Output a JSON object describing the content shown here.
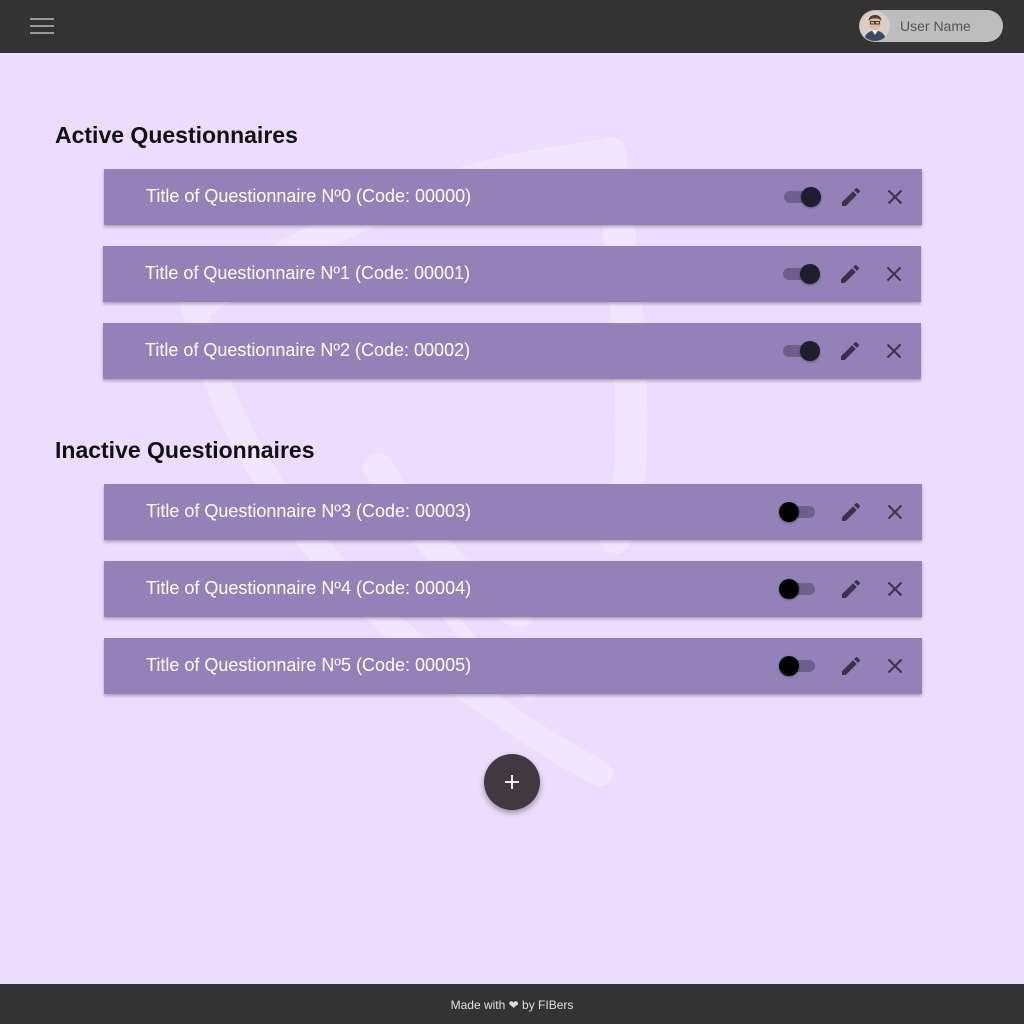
{
  "header": {
    "menu_icon": "hamburger-menu-icon",
    "user": {
      "name": "User Name",
      "avatar": "user-avatar"
    }
  },
  "sections": {
    "active": {
      "title": "Active Questionnaires",
      "items": [
        {
          "title": "Title of Questionnaire Nº0 (Code: 00000)",
          "active": true
        },
        {
          "title": "Title of Questionnaire Nº1 (Code: 00001)",
          "active": true
        },
        {
          "title": "Title of Questionnaire Nº2 (Code: 00002)",
          "active": true
        }
      ]
    },
    "inactive": {
      "title": "Inactive Questionnaires",
      "items": [
        {
          "title": "Title of Questionnaire Nº3 (Code: 00003)",
          "active": false
        },
        {
          "title": "Title of Questionnaire Nº4 (Code: 00004)",
          "active": false
        },
        {
          "title": "Title of Questionnaire Nº5 (Code: 00005)",
          "active": false
        }
      ]
    }
  },
  "actions": {
    "edit_icon": "pencil-icon",
    "delete_icon": "close-icon",
    "add_icon": "plus-icon"
  },
  "footer": {
    "text": "Made with ❤ by FIBers"
  },
  "colors": {
    "background": "#ecdcfd",
    "topbar": "#333333",
    "card": "#9381b7",
    "fab": "#403940"
  }
}
